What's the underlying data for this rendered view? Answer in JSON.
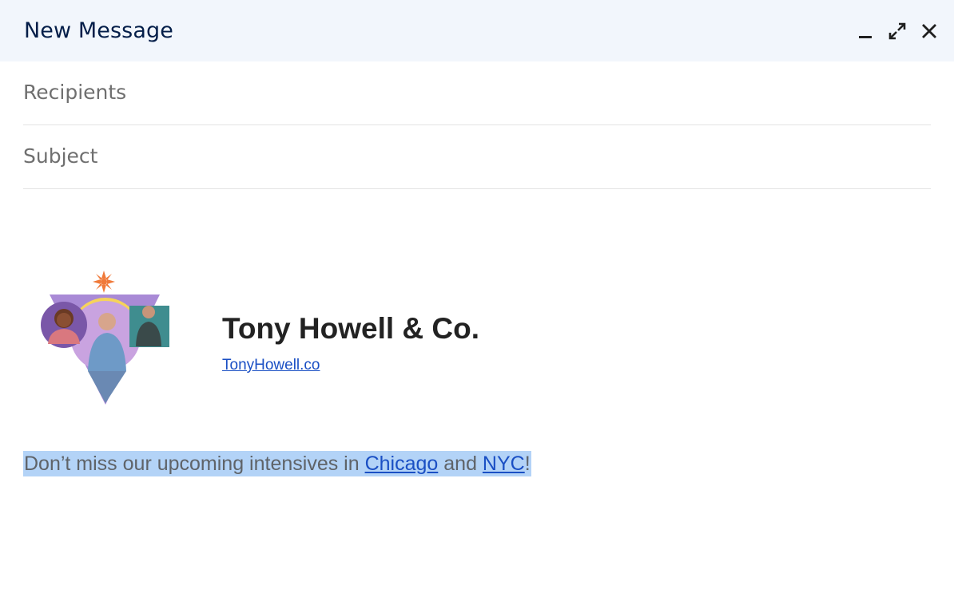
{
  "header": {
    "title": "New Message",
    "minimize_icon": "minimize-icon",
    "expand_icon": "expand-icon",
    "close_icon": "close-icon"
  },
  "fields": {
    "recipients_placeholder": "Recipients",
    "subject_placeholder": "Subject"
  },
  "signature": {
    "name": "Tony Howell & Co.",
    "link": "TonyHowell.co",
    "image_icon": "signature-collage-image"
  },
  "message": {
    "before": "Don’t miss our upcoming intensives in ",
    "link1": "Chicago",
    "middle": " and ",
    "link2": "NYC",
    "after": "!"
  },
  "colors": {
    "header_bg": "#f2f6fc",
    "title": "#041e49",
    "link": "#1a4fc4",
    "selection": "#b3d3f7"
  }
}
